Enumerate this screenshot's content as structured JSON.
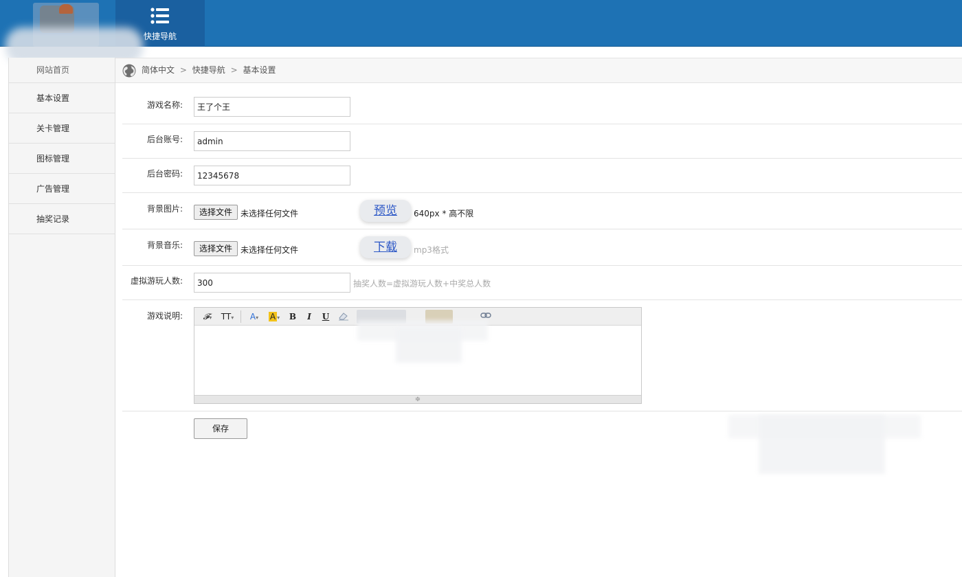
{
  "header": {
    "nav_label": "快捷导航",
    "nav_icon": "list-icon",
    "bg_color": "#1e72b4"
  },
  "sidebar": {
    "items": [
      {
        "label": "网站首页"
      },
      {
        "label": "基本设置"
      },
      {
        "label": "关卡管理"
      },
      {
        "label": "图标管理"
      },
      {
        "label": "广告管理"
      },
      {
        "label": "抽奖记录"
      }
    ]
  },
  "breadcrumb": {
    "items": [
      "简体中文",
      "快捷导航",
      "基本设置"
    ],
    "separator": ">"
  },
  "form": {
    "game_name": {
      "label": "游戏名称:",
      "value": "王了个王"
    },
    "admin_account": {
      "label": "后台账号:",
      "value": "admin"
    },
    "admin_password": {
      "label": "后台密码:",
      "value": "12345678"
    },
    "bg_image": {
      "label": "背景图片:",
      "button": "选择文件",
      "status": "未选择任何文件",
      "action": "预览",
      "note": "640px * 高不限"
    },
    "bg_music": {
      "label": "背景音乐:",
      "button": "选择文件",
      "status": "未选择任何文件",
      "action": "下载",
      "hint": "mp3格式"
    },
    "virtual_players": {
      "label": "虚拟游玩人数:",
      "value": "300",
      "hint": "抽奖人数=虚拟游玩人数+中奖总人数"
    },
    "description": {
      "label": "游戏说明:",
      "toolbar": {
        "font_family": "𝓕",
        "font_size": "TT",
        "font_color": "A",
        "bg_color": "A",
        "bold": "B",
        "italic": "I",
        "underline": "U",
        "dropdown_arrow": "▾"
      },
      "resize_handle": "≑"
    },
    "save_label": "保存"
  }
}
